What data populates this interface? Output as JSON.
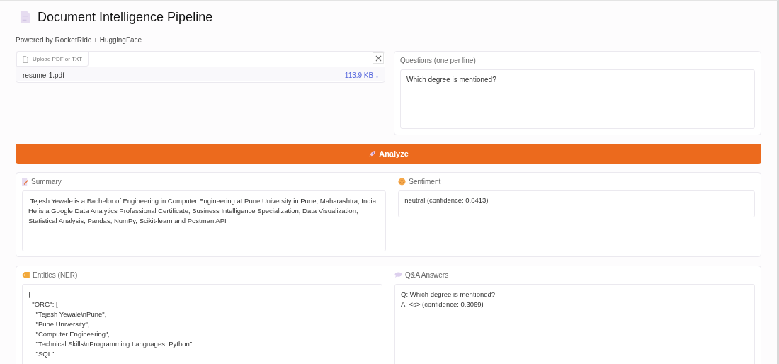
{
  "header": {
    "title": "Document Intelligence Pipeline",
    "subtitle": "Powered by RocketRide + HuggingFace"
  },
  "upload": {
    "label": "Upload PDF or TXT",
    "file_name": "resume-1.pdf",
    "file_size": "113.9 KB ↓"
  },
  "questions": {
    "label": "Questions (one per line)",
    "value": "Which degree is mentioned?"
  },
  "analyze_button": {
    "label": "Analyze"
  },
  "outputs": [
    {
      "kind": "summary",
      "label": "Summary",
      "lines": [
        " Tejesh Yewale is a Bachelor of Engineering in Computer Engineering at Pune University in Pune, Maharashtra, India .",
        "He is a Google Data Analytics Professional Certificate, Business Intelligence Specialization, Data Visualization,",
        "Statistical Analysis, Pandas, NumPy, Scikit-learn and Postman API ."
      ]
    },
    {
      "kind": "sentiment",
      "label": "Sentiment",
      "lines": [
        "neutral (confidence: 0.8413)"
      ]
    },
    {
      "kind": "entities",
      "label": "Entities (NER)",
      "lines": [
        "{",
        "  \"ORG\": [",
        "    \"Tejesh Yewale\\nPune\",",
        "    \"Pune University\",",
        "    \"Computer Engineering\",",
        "    \"Technical Skills\\nProgramming Languages: Python\",",
        "    \"SQL\""
      ]
    },
    {
      "kind": "qa",
      "label": "Q&A Answers",
      "lines": [
        "Q: Which degree is mentioned?",
        "A: <s> (confidence: 0.3069)"
      ]
    }
  ]
}
